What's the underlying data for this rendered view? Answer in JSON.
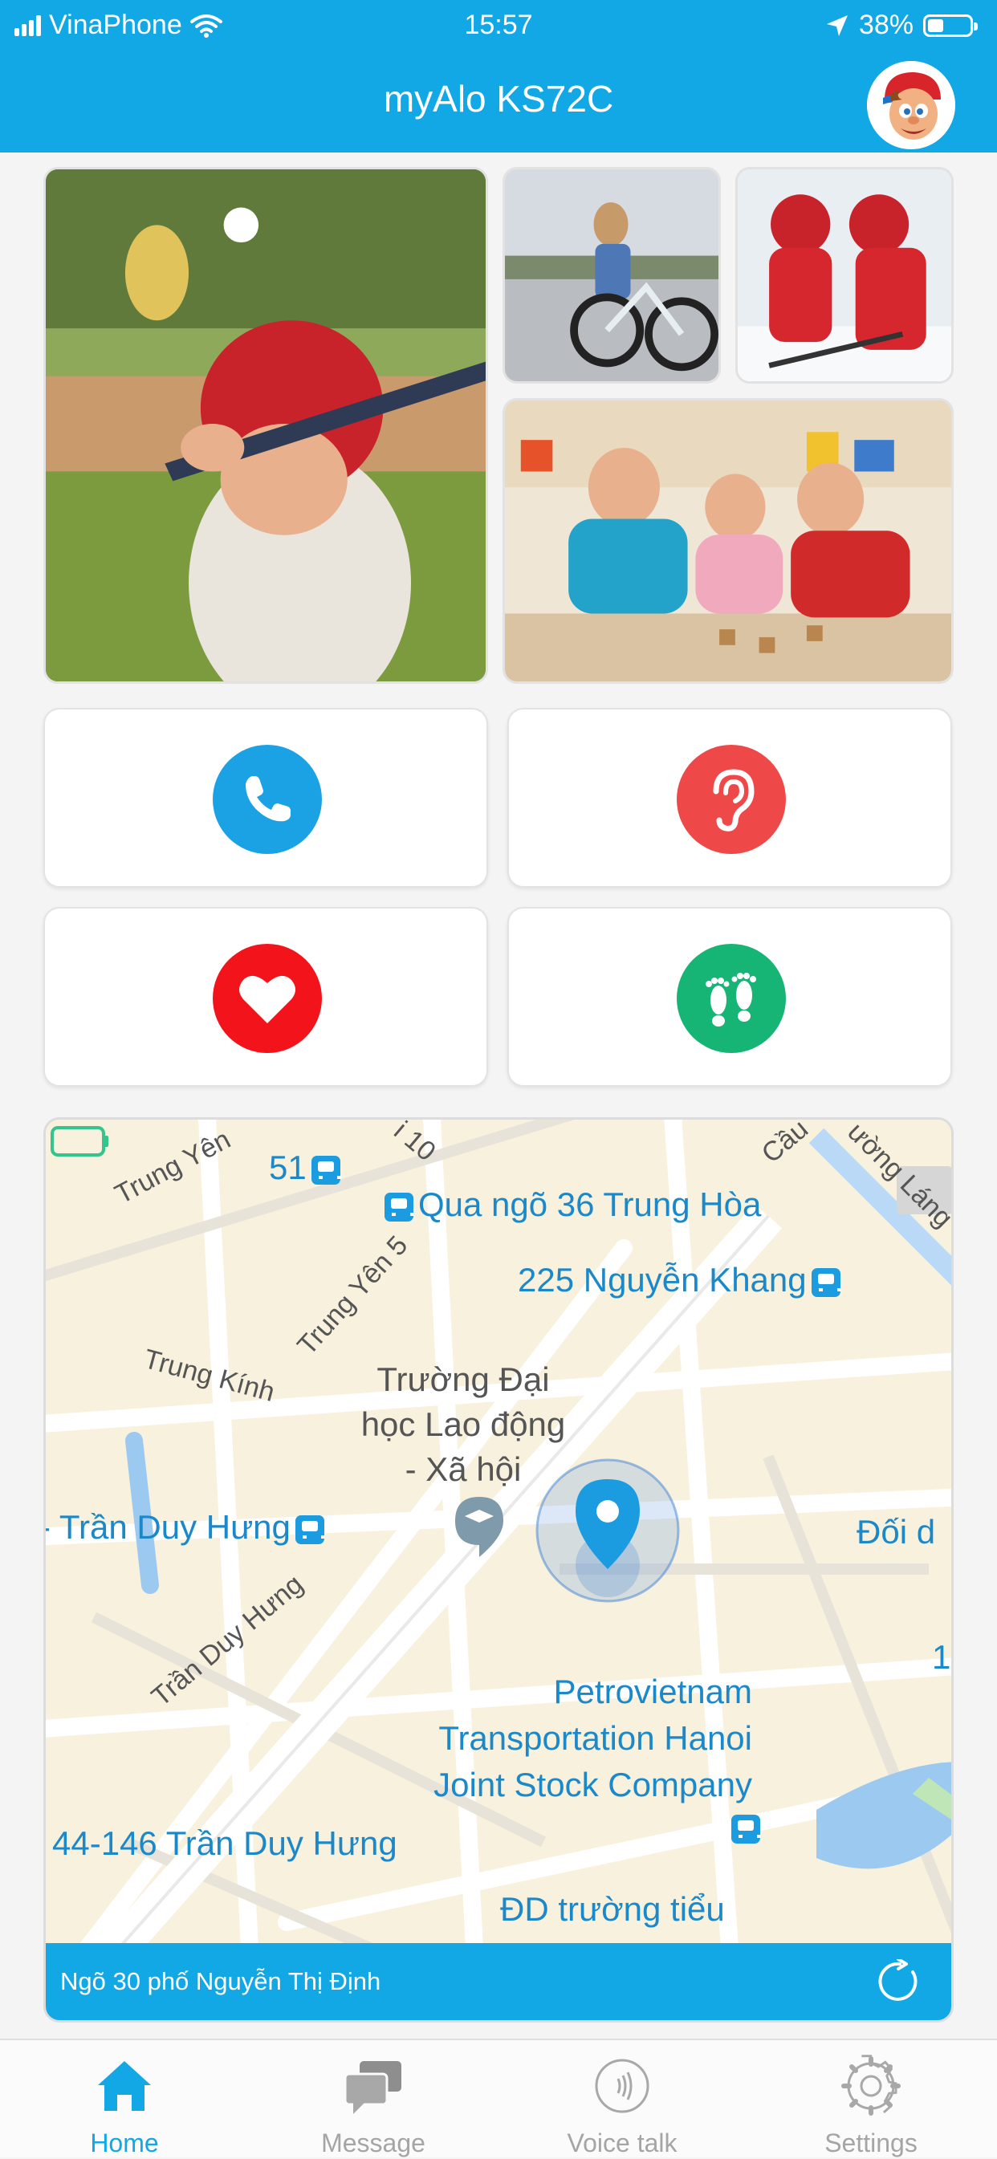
{
  "status_bar": {
    "carrier": "VinaPhone",
    "time": "15:57",
    "battery": "38%"
  },
  "header": {
    "title": "myAlo KS72C"
  },
  "actions": [
    {
      "name": "call",
      "icon": "phone-icon",
      "color": "#1ba2e4"
    },
    {
      "name": "listen",
      "icon": "ear-icon",
      "color": "#ef4848"
    },
    {
      "name": "health",
      "icon": "heart-icon",
      "color": "#f2141a"
    },
    {
      "name": "steps",
      "icon": "footprints-icon",
      "color": "#16b475"
    }
  ],
  "map": {
    "streets": [
      "Trung Yên",
      "i 10",
      "Cầu",
      "ường Láng",
      "Trung Yên 5",
      "Trung Kính",
      "Trần Duy Hưng"
    ],
    "bus_stops": [
      "51",
      "Qua ngõ 36 Trung Hòa",
      "225 Nguyễn Khang",
      "Trần Duy Hưng",
      "44-146 Trần Duy Hưng",
      "Đối d",
      "1"
    ],
    "poi_university": "Trường Đại\nhọc Lao động\n- Xã hội",
    "poi_company": "Petrovietnam\nTransportation Hanoi\nJoint Stock Company",
    "poi_school": "ĐD trường tiểu",
    "address": "Ngõ 30 phố Nguyễn Thị Định"
  },
  "tabs": [
    {
      "label": "Home",
      "icon": "home-icon",
      "active": true
    },
    {
      "label": "Message",
      "icon": "message-icon",
      "active": false
    },
    {
      "label": "Voice talk",
      "icon": "voice-talk-icon",
      "active": false
    },
    {
      "label": "Settings",
      "icon": "settings-icon",
      "active": false
    }
  ],
  "colors": {
    "primary": "#12a8e6",
    "tab_inactive": "#a5a5a5"
  }
}
